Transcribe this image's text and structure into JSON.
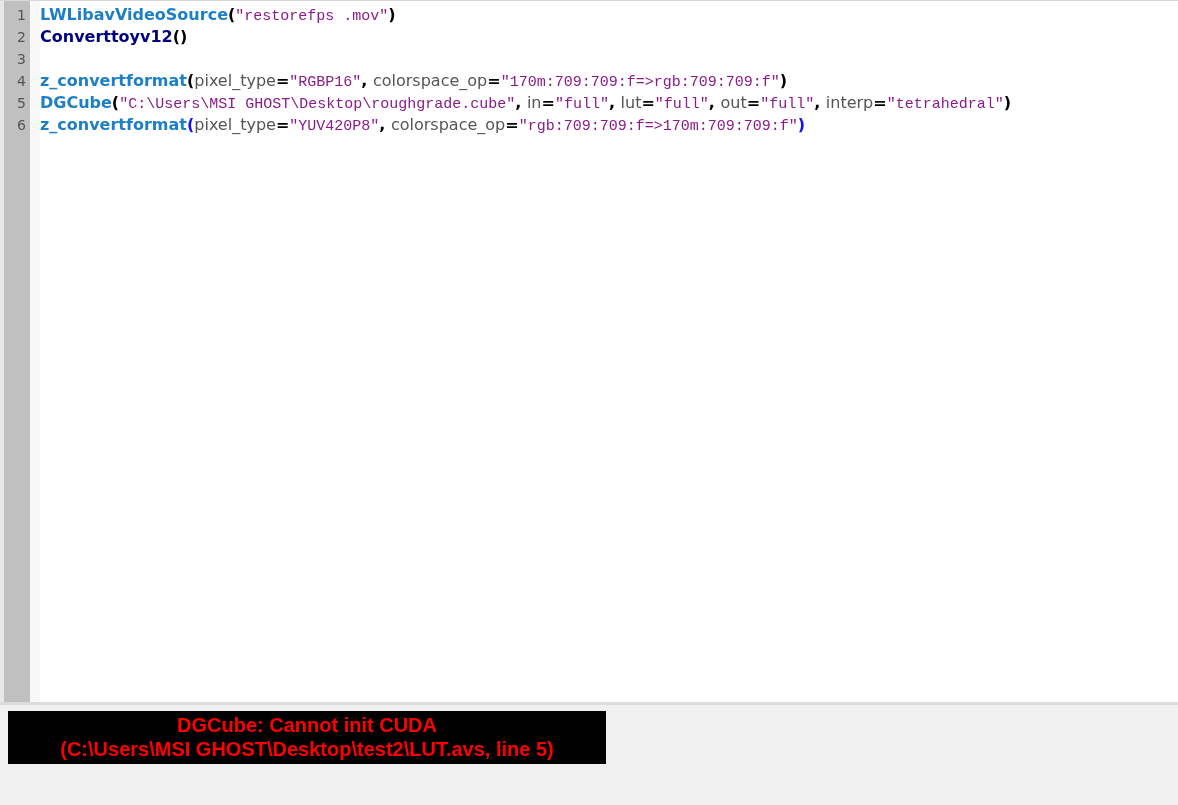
{
  "editor": {
    "lines": [
      {
        "number": "1",
        "tokens": [
          {
            "kind": "func",
            "text": "LWLibavVideoSource"
          },
          {
            "kind": "punct",
            "text": "("
          },
          {
            "kind": "string",
            "text": "\"restorefps .mov\""
          },
          {
            "kind": "punct",
            "text": ")"
          }
        ]
      },
      {
        "number": "2",
        "tokens": [
          {
            "kind": "builtin",
            "text": "Converttoyv12"
          },
          {
            "kind": "punct",
            "text": "()"
          }
        ]
      },
      {
        "number": "3"
      },
      {
        "number": "4",
        "tokens": [
          {
            "kind": "func",
            "text": "z_convertformat"
          },
          {
            "kind": "punct",
            "text": "("
          },
          {
            "kind": "param",
            "text": "pixel_type"
          },
          {
            "kind": "punct",
            "text": "="
          },
          {
            "kind": "string",
            "text": "\"RGBP16\""
          },
          {
            "kind": "punct",
            "text": ", "
          },
          {
            "kind": "param",
            "text": "colorspace_op"
          },
          {
            "kind": "punct",
            "text": "="
          },
          {
            "kind": "string",
            "text": "\"170m:709:709:f=>rgb:709:709:f\""
          },
          {
            "kind": "punct",
            "text": ")"
          }
        ]
      },
      {
        "number": "5",
        "tokens": [
          {
            "kind": "func",
            "text": "DGCube"
          },
          {
            "kind": "punct",
            "text": "("
          },
          {
            "kind": "string",
            "text": "\"C:\\Users\\MSI GHOST\\Desktop\\roughgrade.cube\""
          },
          {
            "kind": "punct",
            "text": ", "
          },
          {
            "kind": "param",
            "text": "in"
          },
          {
            "kind": "punct",
            "text": "="
          },
          {
            "kind": "string",
            "text": "\"full\""
          },
          {
            "kind": "punct",
            "text": ", "
          },
          {
            "kind": "param",
            "text": "lut"
          },
          {
            "kind": "punct",
            "text": "="
          },
          {
            "kind": "string",
            "text": "\"full\""
          },
          {
            "kind": "punct",
            "text": ", "
          },
          {
            "kind": "param",
            "text": "out"
          },
          {
            "kind": "punct",
            "text": "="
          },
          {
            "kind": "string",
            "text": "\"full\""
          },
          {
            "kind": "punct",
            "text": ", "
          },
          {
            "kind": "param",
            "text": "interp"
          },
          {
            "kind": "punct",
            "text": "="
          },
          {
            "kind": "string",
            "text": "\"tetrahedral\""
          },
          {
            "kind": "punct",
            "text": ")"
          }
        ]
      },
      {
        "number": "6",
        "tokens": [
          {
            "kind": "func",
            "text": "z_convertformat"
          },
          {
            "kind": "brace-match",
            "text": "("
          },
          {
            "kind": "param",
            "text": "pixel_type"
          },
          {
            "kind": "punct",
            "text": "="
          },
          {
            "kind": "string",
            "text": "\"YUV420P8\""
          },
          {
            "kind": "punct",
            "text": ", "
          },
          {
            "kind": "param",
            "text": "colorspace_op"
          },
          {
            "kind": "punct",
            "text": "="
          },
          {
            "kind": "string",
            "text": "\"rgb:709:709:f=>170m:709:709:f\""
          },
          {
            "kind": "brace-match",
            "text": ")"
          }
        ]
      }
    ]
  },
  "error": {
    "lines": [
      "DGCube: Cannot init CUDA",
      "(C:\\Users\\MSI GHOST\\Desktop\\test2\\LUT.avs, line 5)"
    ]
  }
}
